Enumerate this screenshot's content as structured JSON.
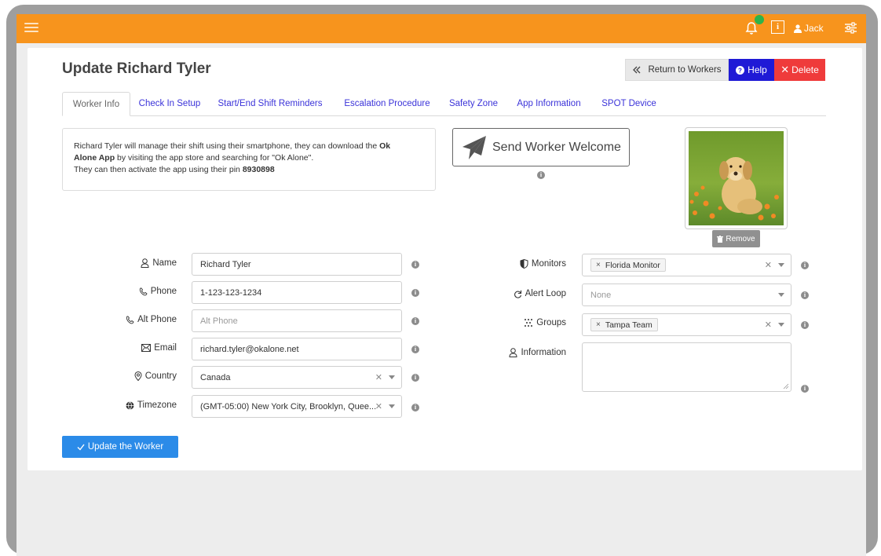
{
  "header": {
    "user_name": "Jack",
    "info_label": "i"
  },
  "page": {
    "title": "Update Richard Tyler"
  },
  "actions": {
    "return_label": "Return to Workers",
    "help_label": "Help",
    "delete_label": "Delete"
  },
  "tabs": [
    {
      "label": "Worker Info",
      "active": true
    },
    {
      "label": "Check In Setup",
      "active": false
    },
    {
      "label": "Start/End Shift Reminders",
      "active": false
    },
    {
      "label": "Escalation Procedure",
      "active": false
    },
    {
      "label": "Safety Zone",
      "active": false
    },
    {
      "label": "App Information",
      "active": false
    },
    {
      "label": "SPOT Device",
      "active": false
    }
  ],
  "notice": {
    "line1_pre": "Richard Tyler will manage their shift using their smartphone, they can download the ",
    "app_name_1": "Ok",
    "app_name_2": "Alone App",
    "line2_post": " by visiting the app store and searching for \"Ok Alone\".",
    "line3_pre": "They can then activate the app using their pin ",
    "pin": "8930898"
  },
  "welcome": {
    "label": "Send Worker Welcome"
  },
  "photo": {
    "remove_label": "Remove"
  },
  "form_left": {
    "name_label": "Name",
    "name_value": "Richard Tyler",
    "phone_label": "Phone",
    "phone_value": "1-123-123-1234",
    "alt_phone_label": "Alt Phone",
    "alt_phone_placeholder": "Alt Phone",
    "email_label": "Email",
    "email_value": "richard.tyler@okalone.net",
    "country_label": "Country",
    "country_value": "Canada",
    "timezone_label": "Timezone",
    "timezone_value": "(GMT-05:00) New York City, Brooklyn, Quee..."
  },
  "form_right": {
    "monitors_label": "Monitors",
    "monitors_chip": "Florida Monitor",
    "alert_loop_label": "Alert Loop",
    "alert_loop_value": "None",
    "groups_label": "Groups",
    "groups_chip": "Tampa Team",
    "information_label": "Information"
  },
  "submit": {
    "label": "Update the Worker"
  },
  "colors": {
    "topbar": "#f7941d",
    "help": "#1f1ad6",
    "delete": "#ef3b3b",
    "primary": "#2b8be8",
    "tab_link": "#3b33d9"
  }
}
